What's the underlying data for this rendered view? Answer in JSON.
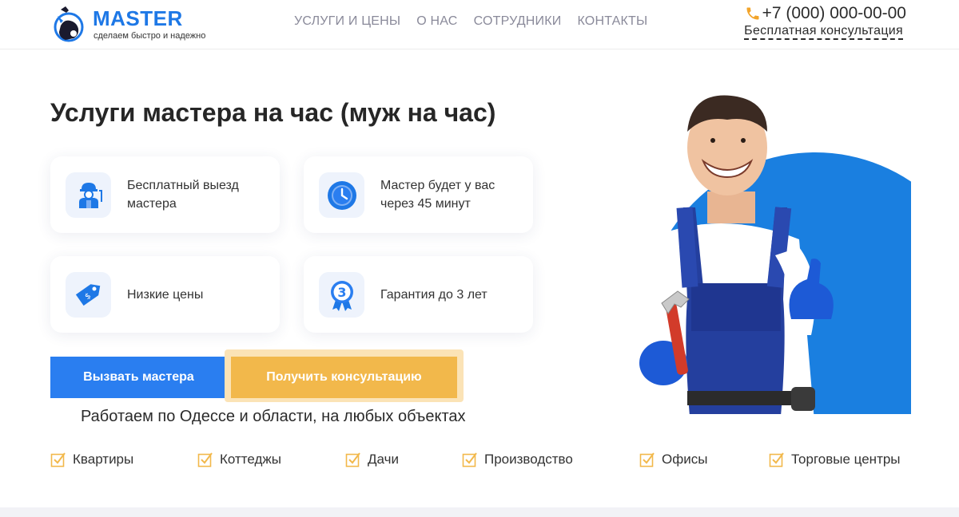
{
  "header": {
    "logo_title": "MASTER",
    "logo_subtitle": "сделаем быстро и надежно",
    "nav": [
      "УСЛУГИ И ЦЕНЫ",
      "О НАС",
      "СОТРУДНИКИ",
      "КОНТАКТЫ"
    ],
    "phone": "+7 (000) 000-00-00",
    "consult_link": "Бесплатная консультация"
  },
  "hero": {
    "title": "Услуги мастера на час (муж на час)",
    "cards": [
      {
        "text": "Бесплатный выезд мастера",
        "icon": "worker-icon"
      },
      {
        "text": "Мастер будет у вас через 45 минут",
        "icon": "clock-icon"
      },
      {
        "text": "Низкие цены",
        "icon": "price-tag-icon"
      },
      {
        "text": "Гарантия до 3 лет",
        "icon": "guarantee-medal-icon"
      }
    ],
    "primary_button": "Вызвать мастера",
    "secondary_button": "Получить консультацию",
    "works_text": "Работаем по Одессе и области, на любых объектах",
    "features": [
      "Квартиры",
      "Коттеджы",
      "Дачи",
      "Производство",
      "Офисы",
      "Торговые центры"
    ]
  },
  "colors": {
    "accent_blue": "#2a7ef0",
    "accent_orange": "#f2b84b",
    "circle_blue": "#1a7fe0"
  }
}
